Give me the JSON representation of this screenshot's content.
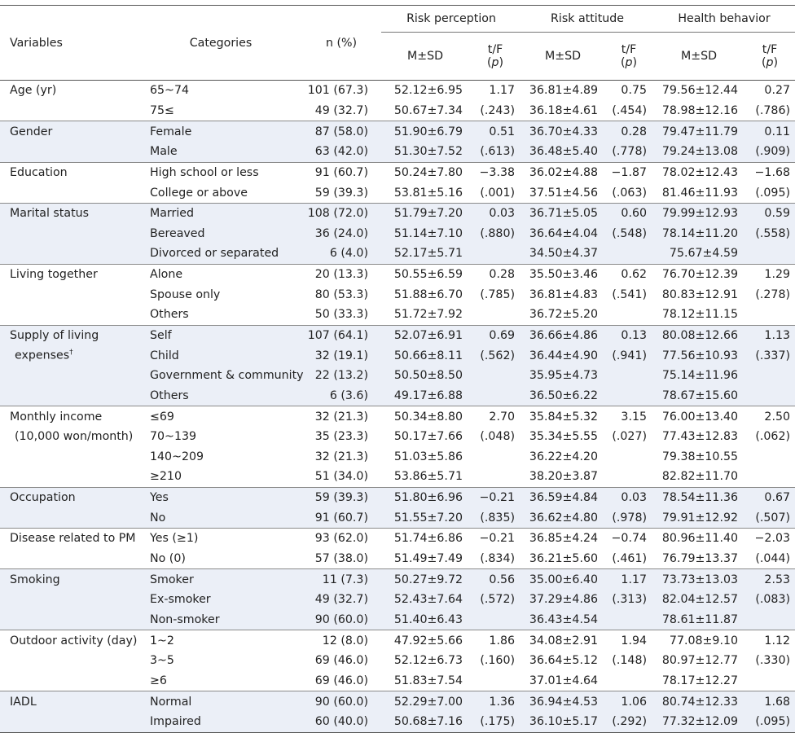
{
  "header": {
    "variables": "Variables",
    "categories": "Categories",
    "n_pct": "n (%)",
    "groups": [
      "Risk perception",
      "Risk attitude",
      "Health behavior"
    ],
    "msd": "M±SD",
    "tf": "t/F",
    "p_open": "(",
    "p": "p",
    "p_close": ")"
  },
  "groups": [
    {
      "label": "Age (yr)",
      "rows": [
        {
          "cat": "65~74",
          "n": "101 (67.3)",
          "rp_m": "52.12±6.95",
          "rp_t": "1.17",
          "ra_m": "36.81±4.89",
          "ra_t": "0.75",
          "hb_m": "79.56±12.44",
          "hb_t": "0.27"
        },
        {
          "cat": "75≤",
          "n": "49 (32.7)",
          "rp_m": "50.67±7.34",
          "rp_t": "(.243)",
          "ra_m": "36.18±4.61",
          "ra_t": "(.454)",
          "hb_m": "78.98±12.16",
          "hb_t": "(.786)"
        }
      ]
    },
    {
      "label": "Gender",
      "rows": [
        {
          "cat": "Female",
          "n": "87 (58.0)",
          "rp_m": "51.90±6.79",
          "rp_t": "0.51",
          "ra_m": "36.70±4.33",
          "ra_t": "0.28",
          "hb_m": "79.47±11.79",
          "hb_t": "0.11"
        },
        {
          "cat": "Male",
          "n": "63 (42.0)",
          "rp_m": "51.30±7.52",
          "rp_t": "(.613)",
          "ra_m": "36.48±5.40",
          "ra_t": "(.778)",
          "hb_m": "79.24±13.08",
          "hb_t": "(.909)"
        }
      ]
    },
    {
      "label": "Education",
      "rows": [
        {
          "cat": "High school or less",
          "n": "91 (60.7)",
          "rp_m": "50.24±7.80",
          "rp_t": "−3.38",
          "ra_m": "36.02±4.88",
          "ra_t": "−1.87",
          "hb_m": "78.02±12.43",
          "hb_t": "−1.68"
        },
        {
          "cat": "College or above",
          "n": "59 (39.3)",
          "rp_m": "53.81±5.16",
          "rp_t": "(.001)",
          "ra_m": "37.51±4.56",
          "ra_t": "(.063)",
          "hb_m": "81.46±11.93",
          "hb_t": "(.095)"
        }
      ]
    },
    {
      "label": "Marital status",
      "rows": [
        {
          "cat": "Married",
          "n": "108 (72.0)",
          "rp_m": "51.79±7.20",
          "rp_t": "0.03",
          "ra_m": "36.71±5.05",
          "ra_t": "0.60",
          "hb_m": "79.99±12.93",
          "hb_t": "0.59"
        },
        {
          "cat": "Bereaved",
          "n": "36 (24.0)",
          "rp_m": "51.14±7.10",
          "rp_t": "(.880)",
          "ra_m": "36.64±4.04",
          "ra_t": "(.548)",
          "hb_m": "78.14±11.20",
          "hb_t": "(.558)"
        },
        {
          "cat": "Divorced or separated",
          "n": "6 (4.0)",
          "rp_m": "52.17±5.71",
          "rp_t": "",
          "ra_m": "34.50±4.37",
          "ra_t": "",
          "hb_m": "75.67±4.59",
          "hb_t": ""
        }
      ]
    },
    {
      "label": "Living  together",
      "rows": [
        {
          "cat": "Alone",
          "n": "20 (13.3)",
          "rp_m": "50.55±6.59",
          "rp_t": "0.28",
          "ra_m": "35.50±3.46",
          "ra_t": "0.62",
          "hb_m": "76.70±12.39",
          "hb_t": "1.29"
        },
        {
          "cat": "Spouse only",
          "n": "80 (53.3)",
          "rp_m": "51.88±6.70",
          "rp_t": "(.785)",
          "ra_m": "36.81±4.83",
          "ra_t": "(.541)",
          "hb_m": "80.83±12.91",
          "hb_t": "(.278)"
        },
        {
          "cat": "Others",
          "n": "50 (33.3)",
          "rp_m": "51.72±7.92",
          "rp_t": "",
          "ra_m": "36.72±5.20",
          "ra_t": "",
          "hb_m": "78.12±11.15",
          "hb_t": ""
        }
      ]
    },
    {
      "label": "Supply of living",
      "label2": "expenses",
      "label2_mark": "†",
      "rows": [
        {
          "cat": "Self",
          "n": "107 (64.1)",
          "rp_m": "52.07±6.91",
          "rp_t": "0.69",
          "ra_m": "36.66±4.86",
          "ra_t": "0.13",
          "hb_m": "80.08±12.66",
          "hb_t": "1.13"
        },
        {
          "cat": "Child",
          "n": "32 (19.1)",
          "rp_m": "50.66±8.11",
          "rp_t": "(.562)",
          "ra_m": "36.44±4.90",
          "ra_t": "(.941)",
          "hb_m": "77.56±10.93",
          "hb_t": "(.337)"
        },
        {
          "cat": "Government & community",
          "n": "22 (13.2)",
          "rp_m": "50.50±8.50",
          "rp_t": "",
          "ra_m": "35.95±4.73",
          "ra_t": "",
          "hb_m": "75.14±11.96",
          "hb_t": ""
        },
        {
          "cat": "Others",
          "n": "6 (3.6)",
          "rp_m": "49.17±6.88",
          "rp_t": "",
          "ra_m": "36.50±6.22",
          "ra_t": "",
          "hb_m": "78.67±15.60",
          "hb_t": ""
        }
      ]
    },
    {
      "label": "Monthly income",
      "label2": "(10,000 won/month)",
      "rows": [
        {
          "cat": "≤69",
          "n": "32 (21.3)",
          "rp_m": "50.34±8.80",
          "rp_t": "2.70",
          "ra_m": "35.84±5.32",
          "ra_t": "3.15",
          "hb_m": "76.00±13.40",
          "hb_t": "2.50"
        },
        {
          "cat": "70~139",
          "n": "35 (23.3)",
          "rp_m": "50.17±7.66",
          "rp_t": "(.048)",
          "ra_m": "35.34±5.55",
          "ra_t": "(.027)",
          "hb_m": "77.43±12.83",
          "hb_t": "(.062)"
        },
        {
          "cat": "140~209",
          "n": "32 (21.3)",
          "rp_m": "51.03±5.86",
          "rp_t": "",
          "ra_m": "36.22±4.20",
          "ra_t": "",
          "hb_m": "79.38±10.55",
          "hb_t": ""
        },
        {
          "cat": "≥210",
          "n": "51 (34.0)",
          "rp_m": "53.86±5.71",
          "rp_t": "",
          "ra_m": "38.20±3.87",
          "ra_t": "",
          "hb_m": "82.82±11.70",
          "hb_t": ""
        }
      ]
    },
    {
      "label": "Occupation",
      "rows": [
        {
          "cat": "Yes",
          "n": "59 (39.3)",
          "rp_m": "51.80±6.96",
          "rp_t": "−0.21",
          "ra_m": "36.59±4.84",
          "ra_t": "0.03",
          "hb_m": "78.54±11.36",
          "hb_t": "0.67"
        },
        {
          "cat": "No",
          "n": "91 (60.7)",
          "rp_m": "51.55±7.20",
          "rp_t": "(.835)",
          "ra_m": "36.62±4.80",
          "ra_t": "(.978)",
          "hb_m": "79.91±12.92",
          "hb_t": "(.507)"
        }
      ]
    },
    {
      "label": "Disease related to PM",
      "rows": [
        {
          "cat": "Yes (≥1)",
          "n": "93 (62.0)",
          "rp_m": "51.74±6.86",
          "rp_t": "−0.21",
          "ra_m": "36.85±4.24",
          "ra_t": "−0.74",
          "hb_m": "80.96±11.40",
          "hb_t": "−2.03"
        },
        {
          "cat": "No (0)",
          "n": "57 (38.0)",
          "rp_m": "51.49±7.49",
          "rp_t": "(.834)",
          "ra_m": "36.21±5.60",
          "ra_t": "(.461)",
          "hb_m": "76.79±13.37",
          "hb_t": "(.044)"
        }
      ]
    },
    {
      "label": "Smoking",
      "rows": [
        {
          "cat": "Smoker",
          "n": "11 (7.3)",
          "rp_m": "50.27±9.72",
          "rp_t": "0.56",
          "ra_m": "35.00±6.40",
          "ra_t": "1.17",
          "hb_m": "73.73±13.03",
          "hb_t": "2.53"
        },
        {
          "cat": "Ex-smoker",
          "n": "49 (32.7)",
          "rp_m": "52.43±7.64",
          "rp_t": "(.572)",
          "ra_m": "37.29±4.86",
          "ra_t": "(.313)",
          "hb_m": "82.04±12.57",
          "hb_t": "(.083)"
        },
        {
          "cat": "Non-smoker",
          "n": "90 (60.0)",
          "rp_m": "51.40±6.43",
          "rp_t": "",
          "ra_m": "36.43±4.54",
          "ra_t": "",
          "hb_m": "78.61±11.87",
          "hb_t": ""
        }
      ]
    },
    {
      "label": "Outdoor activity (day)",
      "rows": [
        {
          "cat": "1~2",
          "n": "12 (8.0)",
          "rp_m": "47.92±5.66",
          "rp_t": "1.86",
          "ra_m": "34.08±2.91",
          "ra_t": "1.94",
          "hb_m": "77.08±9.10",
          "hb_t": "1.12"
        },
        {
          "cat": "3~5",
          "n": "69 (46.0)",
          "rp_m": "52.12±6.73",
          "rp_t": "(.160)",
          "ra_m": "36.64±5.12",
          "ra_t": "(.148)",
          "hb_m": "80.97±12.77",
          "hb_t": "(.330)"
        },
        {
          "cat": "≥6",
          "n": "69 (46.0)",
          "rp_m": "51.83±7.54",
          "rp_t": "",
          "ra_m": "37.01±4.64",
          "ra_t": "",
          "hb_m": "78.17±12.27",
          "hb_t": ""
        }
      ]
    },
    {
      "label": "IADL",
      "rows": [
        {
          "cat": "Normal",
          "n": "90 (60.0)",
          "rp_m": "52.29±7.00",
          "rp_t": "1.36",
          "ra_m": "36.94±4.53",
          "ra_t": "1.06",
          "hb_m": "80.74±12.33",
          "hb_t": "1.68"
        },
        {
          "cat": "Impaired",
          "n": "60 (40.0)",
          "rp_m": "50.68±7.16",
          "rp_t": "(.175)",
          "ra_m": "36.10±5.17",
          "ra_t": "(.292)",
          "hb_m": "77.32±12.09",
          "hb_t": "(.095)"
        }
      ]
    }
  ]
}
